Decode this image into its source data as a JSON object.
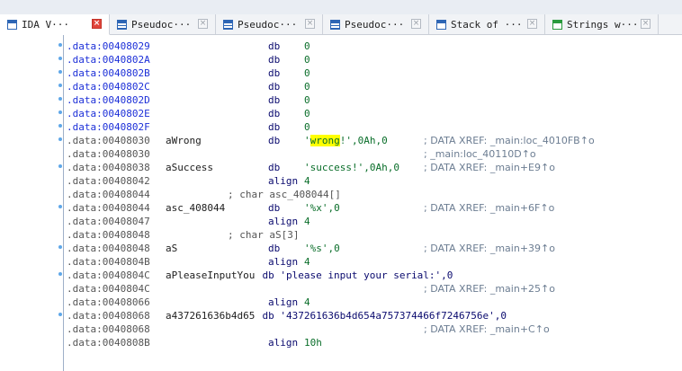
{
  "tabs": [
    {
      "label": "IDA V···",
      "icon": "ida-view-icon",
      "active": true,
      "close": "red"
    },
    {
      "label": "Pseudoc···",
      "icon": "pseudocode-icon",
      "active": false,
      "close": "grey"
    },
    {
      "label": "Pseudoc···",
      "icon": "pseudocode-icon",
      "active": false,
      "close": "grey"
    },
    {
      "label": "Pseudoc···",
      "icon": "pseudocode-icon",
      "active": false,
      "close": "grey"
    },
    {
      "label": "Stack of ···",
      "icon": "stack-icon",
      "active": false,
      "close": "grey"
    },
    {
      "label": "Strings w···",
      "icon": "strings-icon",
      "active": false,
      "close": "grey"
    }
  ],
  "listing": [
    {
      "addr": ".data:00408029",
      "addr_color": "blue",
      "dot": true,
      "ins": "db",
      "ops": "0"
    },
    {
      "addr": ".data:0040802A",
      "addr_color": "blue",
      "dot": true,
      "ins": "db",
      "ops": "0"
    },
    {
      "addr": ".data:0040802B",
      "addr_color": "blue",
      "dot": true,
      "ins": "db",
      "ops": "0"
    },
    {
      "addr": ".data:0040802C",
      "addr_color": "blue",
      "dot": true,
      "ins": "db",
      "ops": "0"
    },
    {
      "addr": ".data:0040802D",
      "addr_color": "blue",
      "dot": true,
      "ins": "db",
      "ops": "0"
    },
    {
      "addr": ".data:0040802E",
      "addr_color": "blue",
      "dot": true,
      "ins": "db",
      "ops": "0"
    },
    {
      "addr": ".data:0040802F",
      "addr_color": "blue",
      "dot": true,
      "ins": "db",
      "ops": "0"
    },
    {
      "addr": ".data:00408030",
      "dot": true,
      "label": "aWrong",
      "ins": "db",
      "ops_pre": "'",
      "ops_hl": "wrong",
      "ops_post": "!',0Ah,0",
      "xref": "; DATA XREF: _main:loc_4010FB↑o"
    },
    {
      "addr": ".data:00408030",
      "dot": false,
      "xref": "; _main:loc_40110D↑o"
    },
    {
      "addr": ".data:00408038",
      "dot": true,
      "label": "aSuccess",
      "ins": "db",
      "ops": "'success!',0Ah,0",
      "xref": "; DATA XREF: _main+E9↑o"
    },
    {
      "addr": ".data:00408042",
      "dot": false,
      "ins": "align",
      "ops": "4"
    },
    {
      "addr": ".data:00408044",
      "dot": false,
      "comment": "; char asc_408044[]"
    },
    {
      "addr": ".data:00408044",
      "dot": true,
      "label": "asc_408044",
      "ins": "db",
      "ops": "'%x',0",
      "xref": "; DATA XREF: _main+6F↑o"
    },
    {
      "addr": ".data:00408047",
      "dot": false,
      "ins": "align",
      "ops": "4"
    },
    {
      "addr": ".data:00408048",
      "dot": false,
      "comment": "; char aS[3]"
    },
    {
      "addr": ".data:00408048",
      "dot": true,
      "label": "aS",
      "ins": "db",
      "ops": "'%s',0",
      "xref": "; DATA XREF: _main+39↑o"
    },
    {
      "addr": ".data:0040804B",
      "dot": false,
      "ins": "align",
      "ops": "4"
    },
    {
      "addr": ".data:0040804C",
      "dot": true,
      "label": "aPleaseInputYou",
      "ins_full": "db 'please input your serial:',0"
    },
    {
      "addr": ".data:0040804C",
      "dot": false,
      "xref": "; DATA XREF: _main+25↑o"
    },
    {
      "addr": ".data:00408066",
      "dot": false,
      "ins": "align",
      "ops": "4"
    },
    {
      "addr": ".data:00408068",
      "dot": true,
      "label": "a437261636b4d65",
      "ins_full": "db '437261636b4d654a757374466f7246756e',0"
    },
    {
      "addr": ".data:00408068",
      "dot": false,
      "xref": "; DATA XREF: _main+C↑o"
    },
    {
      "addr": ".data:0040808B",
      "dot": false,
      "ins": "align",
      "ops": "10h"
    }
  ],
  "colors": {
    "highlight": "#ffff00",
    "address_blue": "#1c2fd8",
    "operand_green": "#0a6e2a",
    "xref_grey": "#6c7d92"
  }
}
